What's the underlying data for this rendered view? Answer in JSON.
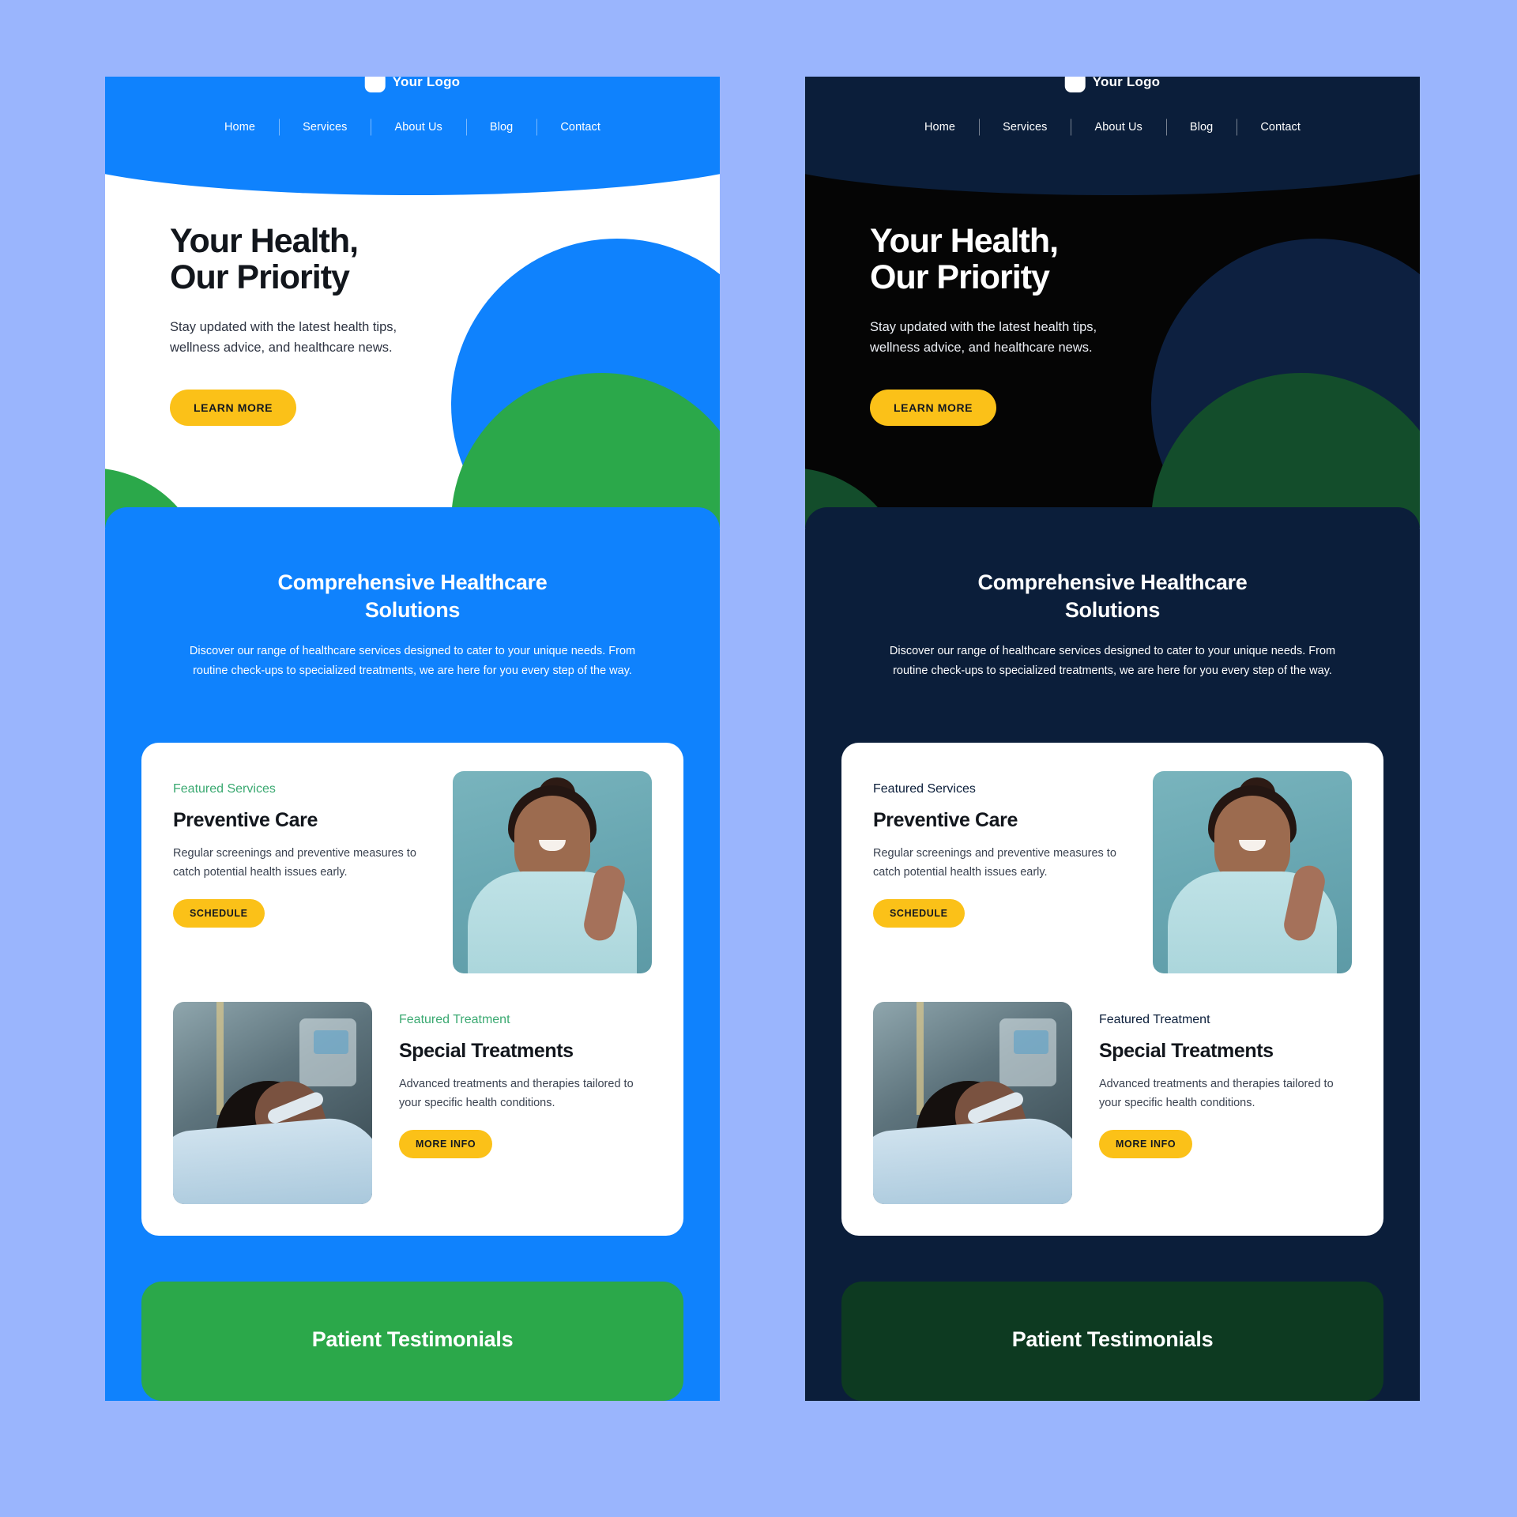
{
  "page": {
    "background_color": "#9ab5fd",
    "variants": [
      "light",
      "dark"
    ]
  },
  "brand": {
    "logo_text": "Your Logo",
    "accent_blue": "#0f82fd",
    "accent_green": "#2ba84a",
    "accent_yellow": "#fbc118",
    "dark_navy": "#0b1e3a",
    "eyebrow_green": "#3aa971"
  },
  "nav": {
    "links": [
      "Home",
      "Services",
      "About Us",
      "Blog",
      "Contact"
    ]
  },
  "hero": {
    "title_line1": "Your Health,",
    "title_line2": "Our Priority",
    "subtitle_line1": "Stay updated with the latest health tips,",
    "subtitle_line2": "wellness advice, and healthcare news.",
    "cta_label": "LEARN MORE"
  },
  "services_band": {
    "title_line1": "Comprehensive Healthcare",
    "title_line2": "Solutions",
    "description": "Discover our range of healthcare services designed to cater to your unique needs. From routine check-ups to specialized treatments, we are here for you every step of the way."
  },
  "cards": {
    "preventive": {
      "eyebrow": "Featured Services",
      "title": "Preventive Care",
      "body": "Regular screenings and preventive measures to catch potential health issues early.",
      "cta_label": "SCHEDULE",
      "image_alt": "smiling-nurse-photo"
    },
    "special": {
      "eyebrow": "Featured Treatment",
      "title": "Special Treatments",
      "body": "Advanced treatments and therapies tailored to your specific health conditions.",
      "cta_label": "MORE INFO",
      "image_alt": "patient-in-hospital-bed-photo"
    }
  },
  "testimonials": {
    "title": "Patient Testimonials"
  }
}
